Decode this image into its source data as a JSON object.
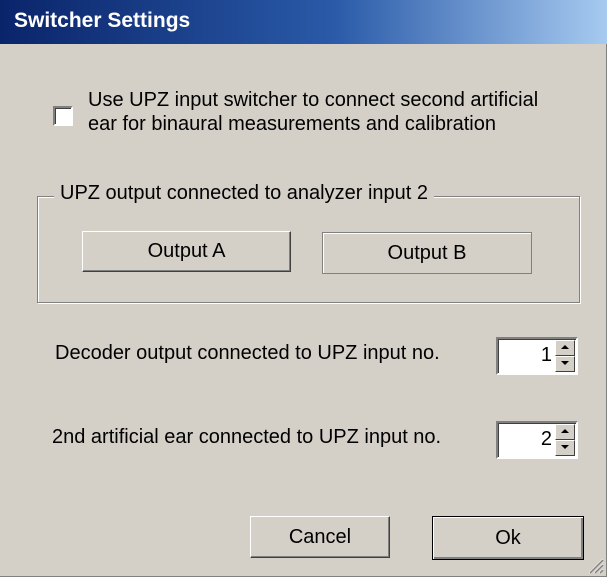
{
  "window": {
    "title": "Switcher Settings"
  },
  "checkbox": {
    "label_line1": "Use UPZ input switcher to connect second artificial",
    "label_line2": "ear for binaural measurements and calibration",
    "checked": false
  },
  "output_group": {
    "legend": "UPZ output connected to analyzer input 2",
    "output_a_label": "Output A",
    "output_b_label": "Output B"
  },
  "decoder": {
    "label": "Decoder output connected to UPZ input no.",
    "value": "1"
  },
  "artificial_ear": {
    "label": "2nd artificial ear connected to UPZ input no.",
    "value": "2"
  },
  "buttons": {
    "cancel_label": "Cancel",
    "ok_label": "Ok"
  }
}
